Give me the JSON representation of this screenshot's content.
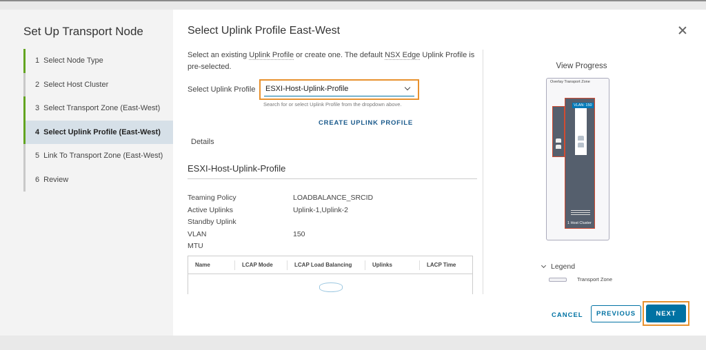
{
  "wizard": {
    "title": "Set Up Transport Node",
    "steps": [
      {
        "num": "1",
        "label": "Select Node Type"
      },
      {
        "num": "2",
        "label": "Select Host Cluster"
      },
      {
        "num": "3",
        "label": "Select Transport Zone (East-West)"
      },
      {
        "num": "4",
        "label": "Select Uplink Profile (East-West)"
      },
      {
        "num": "5",
        "label": "Link To Transport Zone (East-West)"
      },
      {
        "num": "6",
        "label": "Review"
      }
    ],
    "active_step": 4
  },
  "main": {
    "title": "Select Uplink Profile East-West",
    "description": {
      "part1": "Select an existing ",
      "link1": "Uplink Profile",
      "part2": " or create one. The default ",
      "link2": "NSX Edge",
      "part3": " Uplink Profile is pre-selected."
    },
    "uplink_profile_label": "Select Uplink Profile",
    "uplink_profile_value": "ESXI-Host-Uplink-Profile",
    "uplink_profile_hint": "Search for or select Uplink Profile from the dropdown above.",
    "create_link": "CREATE UPLINK PROFILE",
    "details_label": "Details",
    "profile_name": "ESXI-Host-Uplink-Profile",
    "details": [
      {
        "key": "Teaming Policy",
        "value": "LOADBALANCE_SRCID"
      },
      {
        "key": "Active Uplinks",
        "value": "Uplink-1,Uplink-2"
      },
      {
        "key": "Standby Uplink",
        "value": ""
      },
      {
        "key": "VLAN",
        "value": "150"
      },
      {
        "key": "MTU",
        "value": ""
      }
    ],
    "table_columns": [
      "Name",
      "LCAP Mode",
      "LCAP Load Balancing",
      "Uplinks",
      "LACP Time"
    ]
  },
  "progress": {
    "title": "View Progress",
    "zone_label": "Overlay Transport Zone",
    "vlan_tag": "VLAN: 150",
    "cluster_label": "1 Host Cluster",
    "legend_label": "Legend",
    "legend_item": "Transport Zone"
  },
  "footer": {
    "cancel": "CANCEL",
    "previous": "PREVIOUS",
    "next": "NEXT"
  },
  "colors": {
    "accent": "#0072a3",
    "highlight": "#e8912d",
    "step_done": "#62a420",
    "node_fill": "#555f6d",
    "node_border": "#d24b31"
  }
}
